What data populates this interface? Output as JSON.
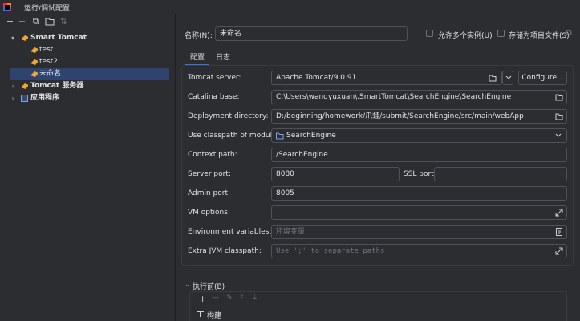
{
  "window": {
    "title": "运行/调试配置"
  },
  "left_toolbar": {
    "add": "+",
    "remove": "—",
    "copy": "⧉",
    "folder": "▭",
    "sort": "⇅"
  },
  "tree": {
    "smart_tomcat": "Smart Tomcat",
    "items": [
      "test",
      "test2",
      "未命名"
    ],
    "tomcat_server": "Tomcat 服务器",
    "app": "应用程序"
  },
  "header": {
    "name_label": "名称(N):",
    "name_value": "未命名",
    "allow_parallel": "允许多个实例(U)",
    "store_as_project_file": "存储为项目文件(S)"
  },
  "tabs": [
    "配置",
    "日志"
  ],
  "form": {
    "tomcat_server_label": "Tomcat server:",
    "tomcat_server_value": "Apache Tomcat/9.0.91",
    "configure_button": "Configure...",
    "catalina_base_label": "Catalina base:",
    "catalina_base_value": "C:\\Users\\wangyuxuan\\.SmartTomcat\\SearchEngine\\SearchEngine",
    "deployment_dir_label": "Deployment directory:",
    "deployment_dir_value": "D:/beginning/homework/爪蛙/submit/SearchEngine/src/main/webApp",
    "classpath_label": "Use classpath of module:",
    "classpath_value": "SearchEngine",
    "context_path_label": "Context path:",
    "context_path_value": "/SearchEngine",
    "server_port_label": "Server port:",
    "server_port_value": "8080",
    "ssl_port_label": "SSL port:",
    "ssl_port_value": "",
    "admin_port_label": "Admin port:",
    "admin_port_value": "8005",
    "vm_options_label": "VM options:",
    "vm_options_value": "",
    "env_vars_label": "Environment variables:",
    "env_vars_placeholder": "环境变量",
    "extra_cp_label": "Extra JVM classpath:",
    "extra_cp_placeholder": "Use ';' to separate paths"
  },
  "before_launch": {
    "title": "执行前(B)",
    "build": "构建"
  },
  "colors": {
    "accent": "#3574f0",
    "selection": "#2e436e",
    "background": "#2b2d30"
  }
}
